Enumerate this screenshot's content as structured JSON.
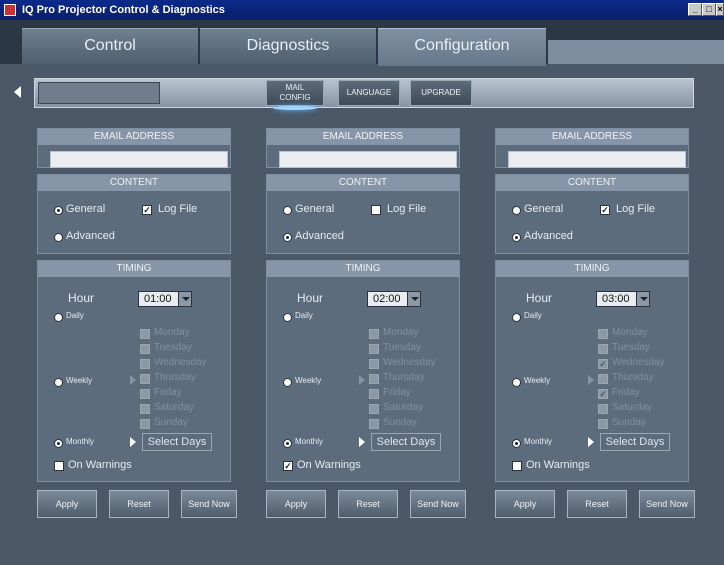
{
  "window": {
    "title": "IQ Pro Projector Control & Diagnostics"
  },
  "tabs": [
    {
      "label": "Control"
    },
    {
      "label": "Diagnostics"
    },
    {
      "label": "Configuration"
    }
  ],
  "strip": {
    "buttons": [
      {
        "label": "MAIL CONFIG",
        "line1": "MAIL",
        "line2": "CONFIG"
      },
      {
        "label": "LANGUAGE"
      },
      {
        "label": "UPGRADE"
      }
    ]
  },
  "columns": [
    {
      "email_header": "EMAIL ADDRESS",
      "email_value": "",
      "content_header": "CONTENT",
      "general": "General",
      "general_selected": true,
      "log_file": "Log File",
      "log_file_checked": true,
      "advanced": "Advanced",
      "advanced_selected": false,
      "timing_header": "TIMING",
      "hour_label": "Hour",
      "hour_value": "01:00",
      "daily": "Daily",
      "weekly": "Weekly",
      "monthly": "Monthly",
      "timing_selected": "monthly",
      "days": [
        "Monday",
        "Tuesday",
        "Wednesday",
        "Thursday",
        "Friday",
        "Saturday",
        "Sunday"
      ],
      "days_checked": [
        false,
        false,
        false,
        false,
        false,
        false,
        false
      ],
      "select_days": "Select Days",
      "on_warnings": "On Warnings",
      "on_warnings_checked": false,
      "apply": "Apply",
      "reset": "Reset",
      "send_now": "Send Now"
    },
    {
      "email_header": "EMAIL ADDRESS",
      "email_value": "",
      "content_header": "CONTENT",
      "general": "General",
      "general_selected": false,
      "log_file": "Log File",
      "log_file_checked": false,
      "advanced": "Advanced",
      "advanced_selected": true,
      "timing_header": "TIMING",
      "hour_label": "Hour",
      "hour_value": "02:00",
      "daily": "Daily",
      "weekly": "Weekly",
      "monthly": "Monthly",
      "timing_selected": "monthly",
      "days": [
        "Monday",
        "Tuesday",
        "Wednesday",
        "Thursday",
        "Friday",
        "Saturday",
        "Sunday"
      ],
      "days_checked": [
        false,
        false,
        false,
        false,
        false,
        false,
        false
      ],
      "select_days": "Select Days",
      "on_warnings": "On Warnings",
      "on_warnings_checked": true,
      "apply": "Apply",
      "reset": "Reset",
      "send_now": "Send Now"
    },
    {
      "email_header": "EMAIL ADDRESS",
      "email_value": "",
      "content_header": "CONTENT",
      "general": "General",
      "general_selected": false,
      "log_file": "Log File",
      "log_file_checked": true,
      "advanced": "Advanced",
      "advanced_selected": true,
      "timing_header": "TIMING",
      "hour_label": "Hour",
      "hour_value": "03:00",
      "daily": "Daily",
      "weekly": "Weekly",
      "monthly": "Monthly",
      "timing_selected": "monthly",
      "days": [
        "Monday",
        "Tuesday",
        "Wednesday",
        "Thursday",
        "Friday",
        "Saturday",
        "Sunday"
      ],
      "days_checked": [
        false,
        false,
        true,
        false,
        true,
        false,
        false
      ],
      "select_days": "Select Days",
      "on_warnings": "On Warnings",
      "on_warnings_checked": false,
      "apply": "Apply",
      "reset": "Reset",
      "send_now": "Send Now"
    }
  ]
}
